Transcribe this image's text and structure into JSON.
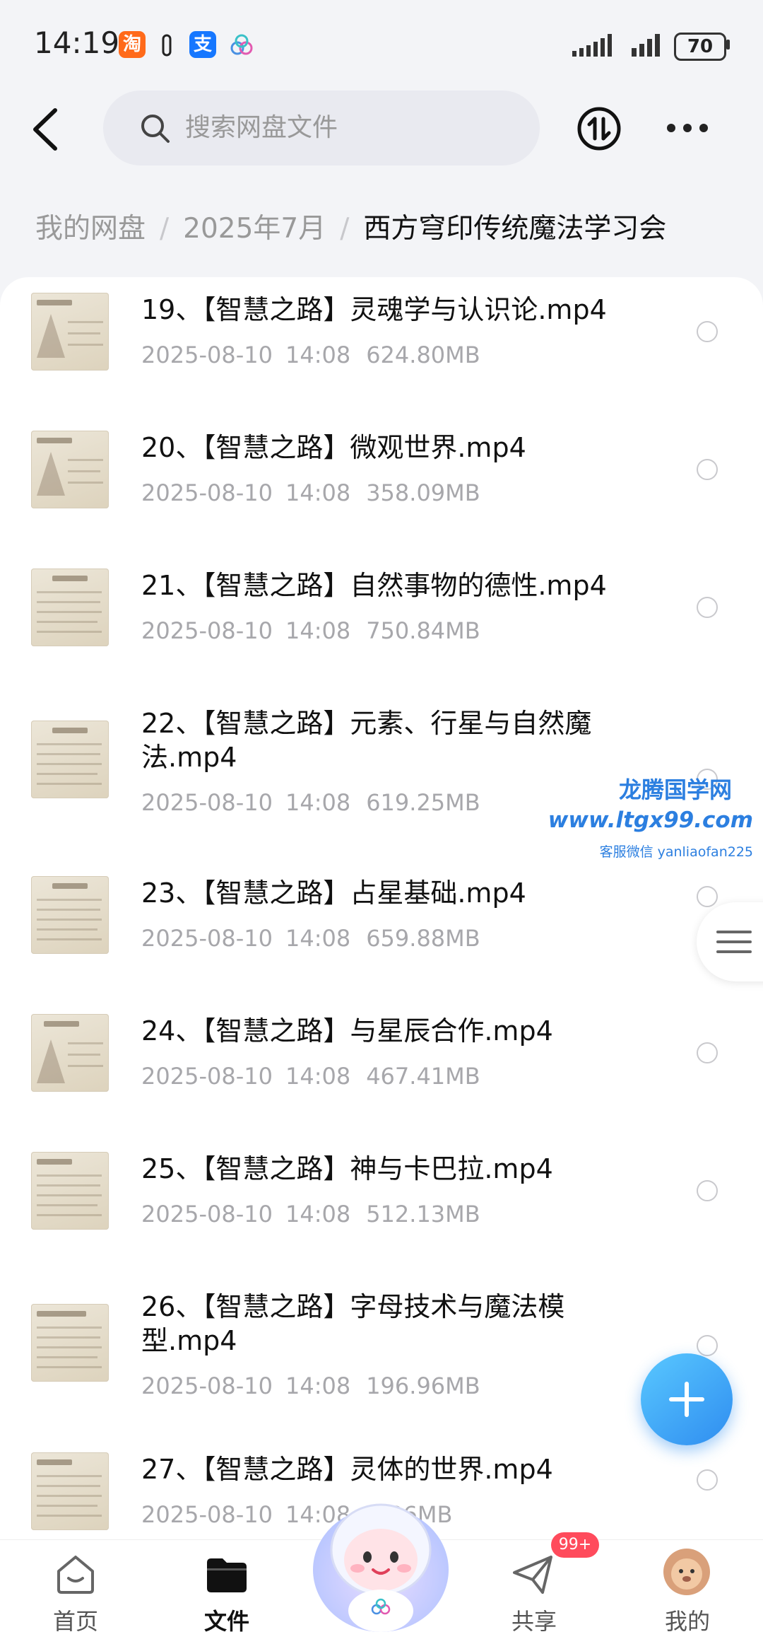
{
  "status_bar": {
    "time": "14:19",
    "battery": "70",
    "apps": [
      "淘",
      "支"
    ]
  },
  "header": {
    "search_placeholder": "搜索网盘文件"
  },
  "breadcrumb": {
    "items": [
      "我的网盘",
      "2025年7月",
      "西方穹印传统魔法学习会"
    ],
    "separator": "/"
  },
  "files": [
    {
      "name": "19、【智慧之路】灵魂学与认识论.mp4",
      "date": "2025-08-10",
      "time": "14:08",
      "size": "624.80MB"
    },
    {
      "name": "20、【智慧之路】微观世界.mp4",
      "date": "2025-08-10",
      "time": "14:08",
      "size": "358.09MB"
    },
    {
      "name": "21、【智慧之路】自然事物的德性.mp4",
      "date": "2025-08-10",
      "time": "14:08",
      "size": "750.84MB"
    },
    {
      "name": "22、【智慧之路】元素、行星与自然魔法.mp4",
      "date": "2025-08-10",
      "time": "14:08",
      "size": "619.25MB"
    },
    {
      "name": "23、【智慧之路】占星基础.mp4",
      "date": "2025-08-10",
      "time": "14:08",
      "size": "659.88MB"
    },
    {
      "name": "24、【智慧之路】与星辰合作.mp4",
      "date": "2025-08-10",
      "time": "14:08",
      "size": "467.41MB"
    },
    {
      "name": "25、【智慧之路】神与卡巴拉.mp4",
      "date": "2025-08-10",
      "time": "14:08",
      "size": "512.13MB"
    },
    {
      "name": "26、【智慧之路】字母技术与魔法模型.mp4",
      "date": "2025-08-10",
      "time": "14:08",
      "size": "196.96MB"
    },
    {
      "name": "27、【智慧之路】灵体的世界.mp4",
      "date": "2025-08-10",
      "time": "14:08",
      "size": "…36MB"
    }
  ],
  "watermark": {
    "line1": "龙腾国学网",
    "line2": "www.ltgx99.com",
    "line3": "客服微信 yanliaofan225"
  },
  "bottom_nav": {
    "tabs": [
      "首页",
      "文件",
      "",
      "共享",
      "我的"
    ],
    "active": "文件",
    "share_badge": "99+"
  },
  "colors": {
    "accent": "#2f8df0",
    "badge": "#ff4b5c"
  },
  "icons": [
    "back-arrow-icon",
    "search-icon",
    "sort-icon",
    "more-icon",
    "menu-icon",
    "plus-icon",
    "home-icon",
    "folder-icon",
    "share-icon",
    "avatar-icon"
  ]
}
